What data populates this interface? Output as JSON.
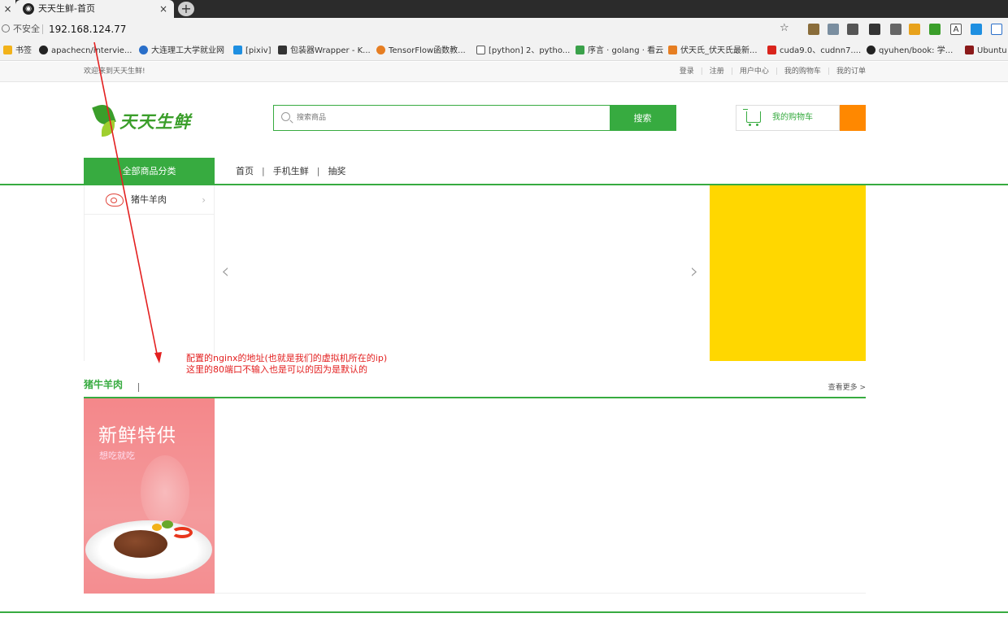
{
  "browser": {
    "tab_title": "天天生鲜-首页",
    "tab_close": "×",
    "new_tab": "+",
    "security_label": "不安全",
    "url": "192.168.124.77",
    "bookmarks": [
      {
        "label": "书签",
        "color": "#f2b21a"
      },
      {
        "label": "apachecn/intervie...",
        "color": "#222222"
      },
      {
        "label": "大连理工大学就业网",
        "color": "#2a6fc9"
      },
      {
        "label": "[pixiv]",
        "color": "#1e8fe1"
      },
      {
        "label": "包装器Wrapper - K...",
        "color": "#333333"
      },
      {
        "label": "TensorFlow函数教...",
        "color": "#e67e22"
      },
      {
        "label": "[python] 2、pytho...",
        "color": "#555555"
      },
      {
        "label": "序言 · golang · 看云",
        "color": "#3aa14a"
      },
      {
        "label": "伏天氏_伏天氏最新...",
        "color": "#e67e22"
      },
      {
        "label": "cuda9.0、cudnn7....",
        "color": "#d9241c"
      },
      {
        "label": "qyuhen/book: 学...",
        "color": "#222222"
      },
      {
        "label": "Ubuntu",
        "color": "#8b1a1a"
      }
    ]
  },
  "site": {
    "welcome": "欢迎来到天天生鲜!",
    "user_links": [
      "登录",
      "注册",
      "用户中心",
      "我的购物车",
      "我的订单"
    ],
    "logo_text": "天天生鲜",
    "search_placeholder": "搜索商品",
    "search_button": "搜索",
    "cart_label": "我的购物车",
    "cart_count": "",
    "all_categories": "全部商品分类",
    "nav_links": [
      "首页",
      "手机生鲜",
      "抽奖"
    ],
    "category_items": [
      "猪牛羊肉"
    ],
    "slider_prev": "‹",
    "slider_next": "›",
    "floor": {
      "title": "猪牛羊肉",
      "more": "查看更多 >",
      "promo_title": "新鲜特供",
      "promo_subtitle": "想吃就吃"
    },
    "annotation": {
      "line1": "配置的nginx的地址(也就是我们的虚拟机所在的ip)",
      "line2": "这里的80端口不输入也是可以的因为是默认的"
    }
  },
  "colors": {
    "brand_green": "#37ab40",
    "cart_orange": "#ff8800",
    "ad_yellow": "#ffd700",
    "annotation_red": "#e32020"
  }
}
